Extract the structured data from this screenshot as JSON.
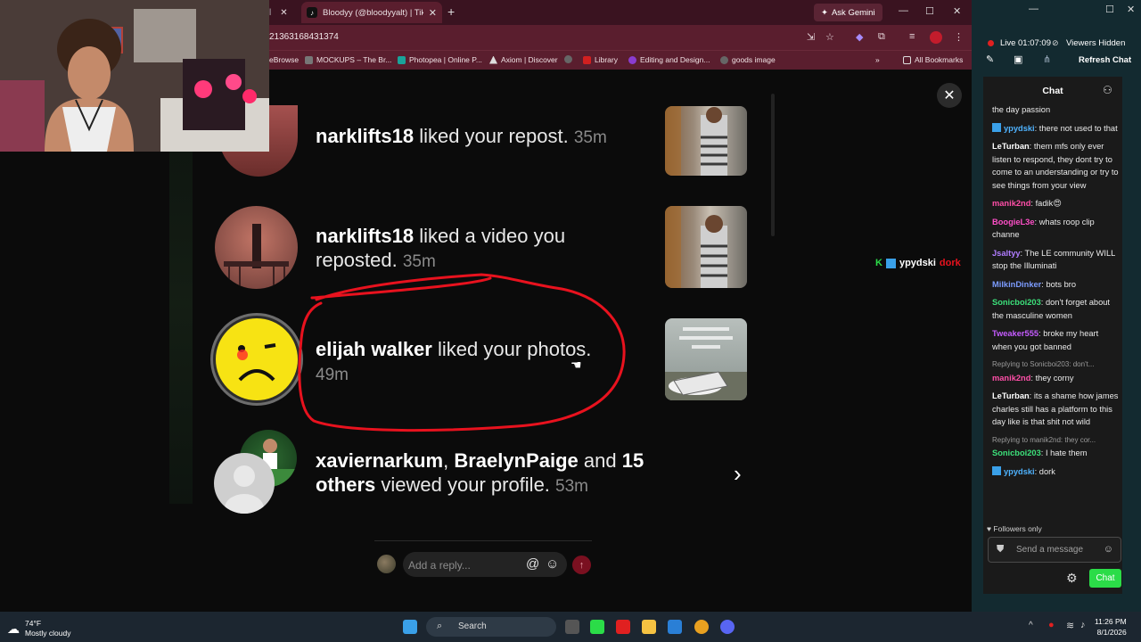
{
  "browser": {
    "prev_tab_label": "l",
    "active_tab_title": "Bloodyy (@bloodyyalt) | TikTok",
    "ask_gemini": "Ask Gemini",
    "url": "21363168431374",
    "bookmarks": [
      {
        "label": "eBrowse",
        "color": "#888"
      },
      {
        "label": "MOCKUPS – The Br...",
        "color": "#777"
      },
      {
        "label": "Photopea | Online P...",
        "color": "#1aa39a"
      },
      {
        "label": "Axiom | Discover",
        "color": "#333"
      },
      {
        "label": "",
        "color": "#555"
      },
      {
        "label": "Library",
        "color": "#d12020"
      },
      {
        "label": "Editing and Design...",
        "color": "#8a3ccf"
      },
      {
        "label": "goods image",
        "color": "#555"
      }
    ],
    "all_bookmarks": "All Bookmarks"
  },
  "notifications": [
    {
      "user": "narklifts18",
      "action": "liked your repost.",
      "time": "35m"
    },
    {
      "user": "narklifts18",
      "action": "liked a video you reposted.",
      "time": "35m"
    },
    {
      "user": "elijah walker",
      "action": "liked your photos.",
      "time": "49m"
    },
    {
      "user1": "xaviernarkum",
      "sep": ",",
      "user2": "BraelynPaige",
      "and": "and",
      "count": "15",
      "others": "others",
      "action": "viewed your profile.",
      "time": "53m"
    }
  ],
  "reply": {
    "placeholder": "Add a reply..."
  },
  "stream": {
    "live_label": "Live",
    "live_time": "01:07:09",
    "viewers": "Viewers Hidden",
    "refresh": "Refresh Chat"
  },
  "overlay_chat": {
    "user1": "ypydski",
    "word": "dork"
  },
  "chat": {
    "header": "Chat",
    "messages": [
      {
        "user": "",
        "text": "the day passion",
        "color": "#eaeaea"
      },
      {
        "user": "ypydski",
        "text": "there not used to that",
        "color": "#4fb3ff",
        "badge": true
      },
      {
        "user": "LeTurban",
        "text": "them mfs only ever listen to respond, they dont try to come to an understanding or try to see things from your view",
        "color": "#ffffff"
      },
      {
        "user": "manik2nd",
        "text": "fadik😍",
        "color": "#ff4fa8"
      },
      {
        "user": "BoogieL3e",
        "text": "whats roop clip channe",
        "color": "#ff4fc8"
      },
      {
        "user": "Jsaltyy",
        "text": "The LE community WILL stop the Illuminati",
        "color": "#b07cff"
      },
      {
        "user": "MilkinDinker",
        "text": "bots bro",
        "color": "#7c9cff"
      },
      {
        "user": "Sonicboi203",
        "text": "don't forget about the masculine women",
        "color": "#3ce07a"
      },
      {
        "user": "Tweaker555",
        "text": "broke my heart when you got banned",
        "color": "#c55cff"
      },
      {
        "reply": "Replying to Sonicboi203: don't..."
      },
      {
        "user": "manik2nd",
        "text": "they corny",
        "color": "#ff4fa8"
      },
      {
        "user": "LeTurban",
        "text": "its a shame how james charles still has a platform to this day like is that shit not wild",
        "color": "#ffffff"
      },
      {
        "reply": "Replying to manik2nd: they cor..."
      },
      {
        "user": "Sonicboi203",
        "text": "I hate them",
        "color": "#3ce07a"
      },
      {
        "user": "ypydski",
        "text": "dork",
        "color": "#4fb3ff",
        "badge": true
      }
    ],
    "followers_only": "Followers only",
    "send_placeholder": "Send a message",
    "chat_button": "Chat"
  },
  "taskbar": {
    "temp": "74°F",
    "weather": "Mostly cloudy",
    "search": "Search",
    "time": "11:26 PM",
    "date": "8/1/2026"
  },
  "colors": {
    "accent_tiktok_red": "#7a1020",
    "chat_green": "#2bdc48",
    "annotation": "#e8121e"
  }
}
